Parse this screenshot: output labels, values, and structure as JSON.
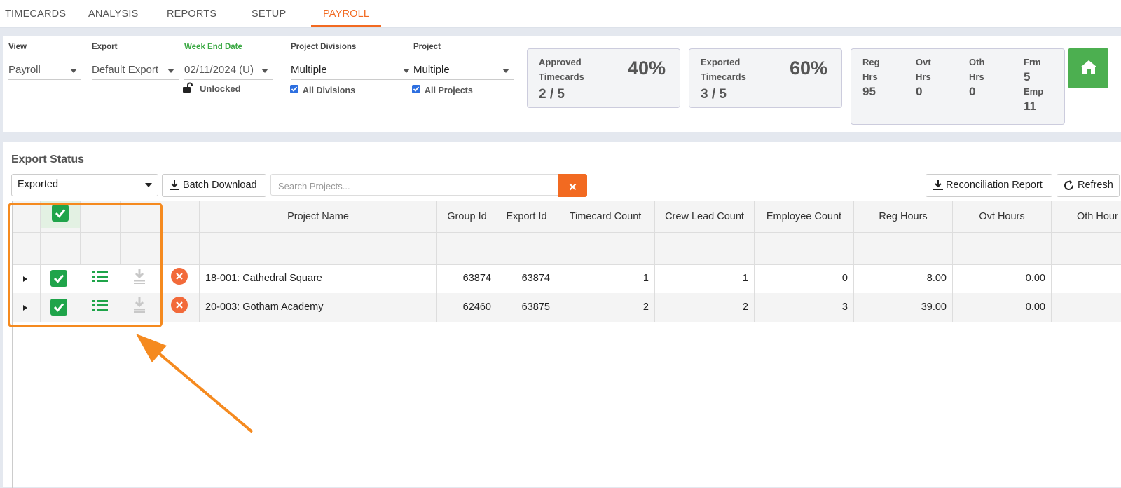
{
  "tabs": [
    "TIMECARDS",
    "ANALYSIS",
    "REPORTS",
    "SETUP",
    "PAYROLL"
  ],
  "filters": {
    "view_label": "View",
    "view_value": "Payroll",
    "export_label": "Export",
    "export_value": "Default Export",
    "week_label": "Week End Date",
    "week_value": "02/11/2024 (U)",
    "lock_text": "Unlocked",
    "divisions_label": "Project Divisions",
    "divisions_value": "Multiple",
    "divisions_check": "All Divisions",
    "project_label": "Project",
    "project_value": "Multiple",
    "project_check": "All Projects"
  },
  "cards": {
    "approved_line1": "Approved",
    "approved_line2": "Timecards",
    "approved_pct": "40%",
    "approved_count": "2 / 5",
    "exported_line1": "Exported",
    "exported_line2": "Timecards",
    "exported_pct": "60%",
    "exported_count": "3 / 5"
  },
  "stats": {
    "reg_l1": "Reg",
    "reg_l2": "Hrs",
    "reg_v": "95",
    "ovt_l1": "Ovt",
    "ovt_l2": "Hrs",
    "ovt_v": "0",
    "oth_l1": "Oth",
    "oth_l2": "Hrs",
    "oth_v": "0",
    "frm_l": "Frm",
    "frm_v": "5",
    "emp_l": "Emp",
    "emp_v": "11"
  },
  "export_status": {
    "title": "Export Status",
    "dropdown_value": "Exported",
    "batch_download": "Batch Download",
    "search_placeholder": "Search Projects...",
    "reconciliation": "Reconciliation Report",
    "refresh": "Refresh"
  },
  "table": {
    "headers": [
      "Project Name",
      "Group Id",
      "Export Id",
      "Timecard Count",
      "Crew Lead Count",
      "Employee Count",
      "Reg Hours",
      "Ovt Hours",
      "Oth Hour"
    ],
    "rows": [
      {
        "project": "18-001: Cathedral Square",
        "group_id": "63874",
        "export_id": "63874",
        "timecard_count": "1",
        "crew_lead_count": "1",
        "employee_count": "0",
        "reg_hours": "8.00",
        "ovt_hours": "0.00"
      },
      {
        "project": "20-003: Gotham Academy",
        "group_id": "62460",
        "export_id": "63875",
        "timecard_count": "2",
        "crew_lead_count": "2",
        "employee_count": "3",
        "reg_hours": "39.00",
        "ovt_hours": "0.00"
      }
    ]
  },
  "colors": {
    "accent_orange": "#f26a21",
    "highlight_orange": "#f58a1f",
    "check_green": "#1fa44a",
    "home_green": "#4caf50",
    "week_label_green": "#3aa843"
  }
}
